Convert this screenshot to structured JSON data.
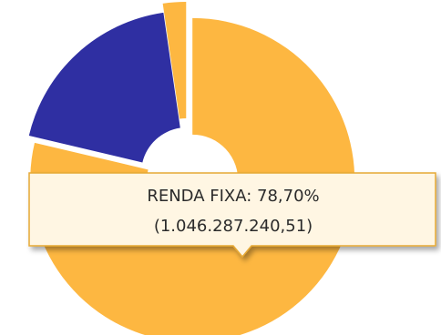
{
  "chart_data": {
    "type": "pie",
    "style": "donut",
    "slices": [
      {
        "label": "RENDA FIXA",
        "percent": 78.7,
        "color": "#FDB741",
        "exploded": true
      },
      {
        "label": "",
        "percent": 19.0,
        "color": "#2F2FA2",
        "exploded": false
      },
      {
        "label": "",
        "percent": 2.3,
        "color": "#FDB741",
        "exploded": true
      }
    ],
    "tooltip": {
      "line1": "RENDA FIXA: 78,70%",
      "line2": "(1.046.287.240,51)",
      "background": "#FFF6E3",
      "border": "#E6A935"
    }
  }
}
